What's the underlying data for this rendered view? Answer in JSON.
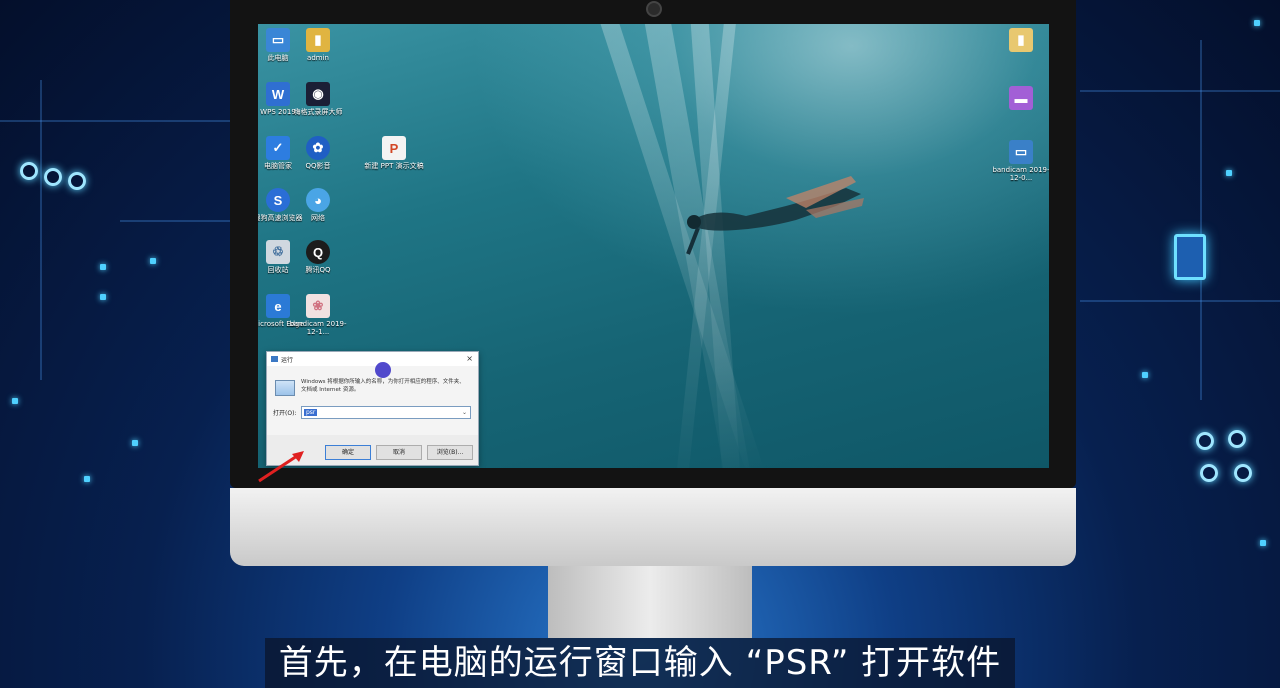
{
  "desktop_icons": [
    {
      "name": "computer",
      "label": "此电脑",
      "color": "#3a86d6",
      "glyph": "▭"
    },
    {
      "name": "admin",
      "label": "admin",
      "color": "#e0b441",
      "glyph": "▮"
    },
    {
      "name": "wps",
      "label": "WPS 2019",
      "color": "#2f6fd2",
      "glyph": "W"
    },
    {
      "name": "recorder",
      "label": "嗨格式录屏大师",
      "color": "#1b1f36",
      "glyph": "◉"
    },
    {
      "name": "pc-manager",
      "label": "电脑管家",
      "color": "#2d7de0",
      "glyph": "✓"
    },
    {
      "name": "qq-music",
      "label": "QQ影音",
      "color": "#1f5fc4",
      "glyph": "✿"
    },
    {
      "name": "ppt",
      "label": "新建 PPT 演示文稿",
      "color": "#f3f3f3",
      "glyph": "P"
    },
    {
      "name": "sogou-browser",
      "label": "搜狗高速浏览器",
      "color": "#2a6ed6",
      "glyph": "S"
    },
    {
      "name": "network",
      "label": "网络",
      "color": "#4aa5e6",
      "glyph": "◕"
    },
    {
      "name": "recycle-bin",
      "label": "回收站",
      "color": "#d0d8e0",
      "glyph": "♲"
    },
    {
      "name": "qq",
      "label": "腾讯QQ",
      "color": "#1c1c1c",
      "glyph": "Q"
    },
    {
      "name": "edge",
      "label": "Microsoft Edge",
      "color": "#2b7ad6",
      "glyph": "e"
    },
    {
      "name": "bandicam-file",
      "label": "bandicam 2019-12-1...",
      "color": "#f1e1e1",
      "glyph": "❀"
    },
    {
      "name": "right-file",
      "label": "",
      "color": "#e8c870",
      "glyph": "▮"
    },
    {
      "name": "right-app-1",
      "label": "",
      "color": "#a25fd6",
      "glyph": "▬"
    },
    {
      "name": "bandicam-right",
      "label": "bandicam 2019-12-0...",
      "color": "#3a80c8",
      "glyph": "▭"
    }
  ],
  "run_dialog": {
    "title": "运行",
    "message": "Windows 将根据你所输入的名称，为你打开相应的程序、文件夹、文档或 Internet 资源。",
    "open_label": "打开(O):",
    "open_value": "psr",
    "ok_label": "确定",
    "cancel_label": "取消",
    "browse_label": "浏览(B)...",
    "close_glyph": "×"
  },
  "subtitle": "首先，在电脑的运行窗口输入 “PSR” 打开软件",
  "colors": {
    "accent": "#3c7fd6",
    "arrow": "#e02020"
  }
}
